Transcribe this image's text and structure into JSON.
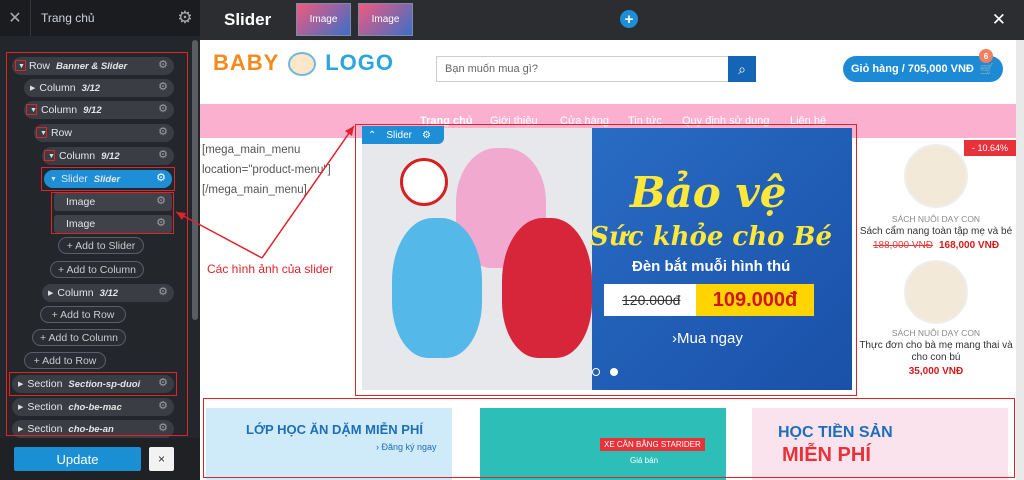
{
  "panel": {
    "title": "Trang chủ",
    "tree": {
      "row1": {
        "type": "Row",
        "name": "Banner & Slider"
      },
      "col1": {
        "type": "Column",
        "name": "3/12"
      },
      "col2": {
        "type": "Column",
        "name": "9/12"
      },
      "row2": {
        "type": "Row"
      },
      "col3": {
        "type": "Column",
        "name": "9/12"
      },
      "slider": {
        "type": "Slider",
        "name": "Slider"
      },
      "image1": {
        "type": "Image"
      },
      "image2": {
        "type": "Image"
      },
      "add_slider": "+ Add to Slider",
      "add_column1": "+ Add to Column",
      "col4": {
        "type": "Column",
        "name": "3/12"
      },
      "add_row1": "+ Add to Row",
      "add_column2": "+ Add to Column",
      "add_row2": "+ Add to Row",
      "section1": {
        "type": "Section",
        "name": "Section-sp-duoi"
      },
      "section2": {
        "type": "Section",
        "name": "cho-be-mac"
      },
      "section3": {
        "type": "Section",
        "name": "cho-be-an"
      }
    },
    "update_label": "Update",
    "close_label": "×"
  },
  "topbar": {
    "title": "Slider",
    "thumbs": [
      "Image",
      "Image"
    ],
    "add_label": "+",
    "close_label": "✕"
  },
  "site": {
    "logo": {
      "part1": "BABY",
      "part2": "LOGO"
    },
    "search_placeholder": "Bạn muốn mua gì?",
    "cart_label": "Giỏ hàng / 705,000 VNĐ",
    "cart_count": "6",
    "nav": [
      "Trang chủ",
      "Giới thiệu",
      "Cửa hàng",
      "Tin tức",
      "Quy định sử dụng",
      "Liên hệ"
    ],
    "shortcode": [
      "[mega_main_menu",
      "location=\"product-menu\"]",
      "[/mega_main_menu]"
    ],
    "slider_tab": "Slider",
    "slide": {
      "heading": "Bảo vệ",
      "sub": "Sức khỏe cho Bé",
      "desc": "Đèn bắt muỗi hình thú",
      "old_price": "120.000đ",
      "new_price": "109.000đ",
      "cta": "›Mua ngay"
    },
    "discount": "- 10.64%",
    "products": [
      {
        "category": "SÁCH NUÔI DẠY CON",
        "title": "Sách cẩm nang toàn tập mẹ và bé",
        "old_price": "188,000 VNĐ",
        "new_price": "168,000 VNĐ"
      },
      {
        "category": "SÁCH NUÔI DẠY CON",
        "title": "Thực đơn cho bà mẹ mang thai và cho con bú",
        "old_price": "",
        "new_price": "35,000 VNĐ"
      }
    ],
    "banners": [
      {
        "title": "LỚP HỌC ĂN DẶM MIỄN PHÍ",
        "sub": "› Đăng ký ngay"
      },
      {
        "title": "XE CÂN BẰNG STARIDER",
        "sub": "Giá bán"
      },
      {
        "title": "HỌC TIỀN SẢN",
        "sub": "MIỄN PHÍ"
      }
    ]
  },
  "annotation": {
    "text": "Các hình ảnh của slider"
  },
  "colors": {
    "accent": "#1e8fd6",
    "annotation_red": "#e0232a",
    "nav_pink": "#fbb0d0"
  }
}
